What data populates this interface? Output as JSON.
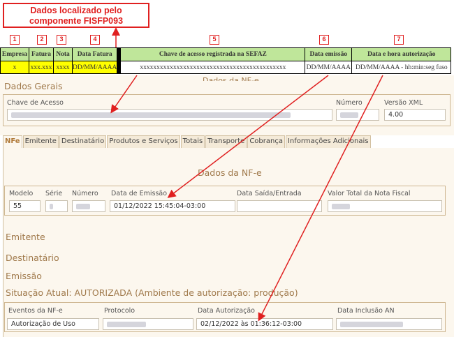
{
  "annotation": {
    "callout_line1": "Dados localizado pelo",
    "callout_line2": "componente FISFP093",
    "numbers": [
      "1",
      "2",
      "3",
      "4",
      "5",
      "6",
      "7"
    ],
    "colors": {
      "annotation_red": "#e02020",
      "yellow": "#ffff00",
      "green": "#bfe69a"
    }
  },
  "grid": {
    "headers": [
      "Empresa",
      "Fatura",
      "Nota",
      "Data Fatura",
      "Chave de acesso registrada na SEFAZ",
      "Data emissão",
      "Data e hora autorização"
    ],
    "values": [
      "x",
      "xxx.xxx",
      "xxxx",
      "DD/MM/AAAA",
      "xxxxxxxxxxxxxxxxxxxxxxxxxxxxxxxxxxxxxxxxxxxx",
      "DD/MM/AAAA",
      "DD/MM/AAAA - hh:min:seg fuso"
    ]
  },
  "page": {
    "section_dados_gerais": "Dados Gerais",
    "title_partial": "Dados da NF-e",
    "chave_label": "Chave de Acesso",
    "numero_label": "Número",
    "versao_label": "Versão XML",
    "versao_value": "4.00",
    "tabs": [
      "NFe",
      "Emitente",
      "Destinatário",
      "Produtos e Serviços",
      "Totais",
      "Transporte",
      "Cobrança",
      "Informações Adicionais"
    ],
    "dados_nfe_title": "Dados da NF-e",
    "nfe_fields": {
      "modelo_label": "Modelo",
      "modelo_value": "55",
      "serie_label": "Série",
      "numero_label": "Número",
      "emissao_label": "Data de Emissão",
      "emissao_value": "01/12/2022 15:45:04-03:00",
      "saida_label": "Data Saída/Entrada",
      "valor_label": "Valor Total da Nota Fiscal"
    },
    "emitente": "Emitente",
    "destinatario": "Destinatário",
    "emissao": "Emissão",
    "situacao": "Situação Atual: AUTORIZADA (Ambiente de autorização: produção)",
    "eventos": {
      "eventos_label": "Eventos da NF-e",
      "eventos_value": "Autorização de Uso",
      "protocolo_label": "Protocolo",
      "data_aut_label": "Data Autorização",
      "data_aut_value": "02/12/2022 às 01:36:12-03:00",
      "data_inc_label": "Data Inclusão AN"
    }
  }
}
